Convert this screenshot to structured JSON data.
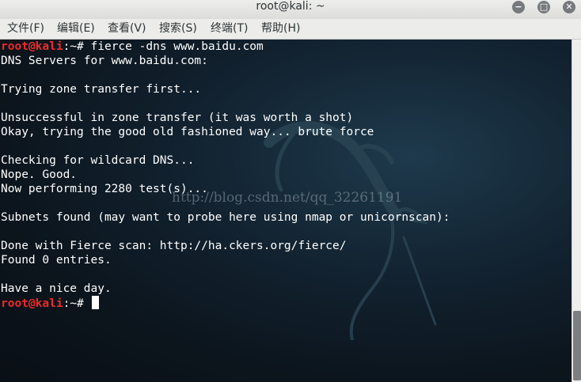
{
  "window": {
    "title": "root@kali: ~",
    "buttons": {
      "minimize": "−",
      "maximize": "□",
      "close": "✕"
    }
  },
  "menu": {
    "items": [
      {
        "label": "文件(F)"
      },
      {
        "label": "编辑(E)"
      },
      {
        "label": "查看(V)"
      },
      {
        "label": "搜索(S)"
      },
      {
        "label": "终端(T)"
      },
      {
        "label": "帮助(H)"
      }
    ]
  },
  "terminal": {
    "prompt": {
      "user_host": "root@kali",
      "path": ":~",
      "symbol": "# "
    },
    "command": "fierce -dns www.baidu.com",
    "output": [
      "DNS Servers for www.baidu.com:",
      "",
      "Trying zone transfer first...",
      "",
      "Unsuccessful in zone transfer (it was worth a shot)",
      "Okay, trying the good old fashioned way... brute force",
      "",
      "Checking for wildcard DNS...",
      "Nope. Good.",
      "Now performing 2280 test(s)...",
      "",
      "Subnets found (may want to probe here using nmap or unicornscan):",
      "",
      "Done with Fierce scan: http://ha.ckers.org/fierce/",
      "Found 0 entries.",
      "",
      "Have a nice day."
    ],
    "watermark": "http://blog.csdn.net/qq_32261191"
  },
  "colors": {
    "prompt_user": "#ef2929",
    "text": "#ffffff",
    "background": "#0c151d"
  }
}
